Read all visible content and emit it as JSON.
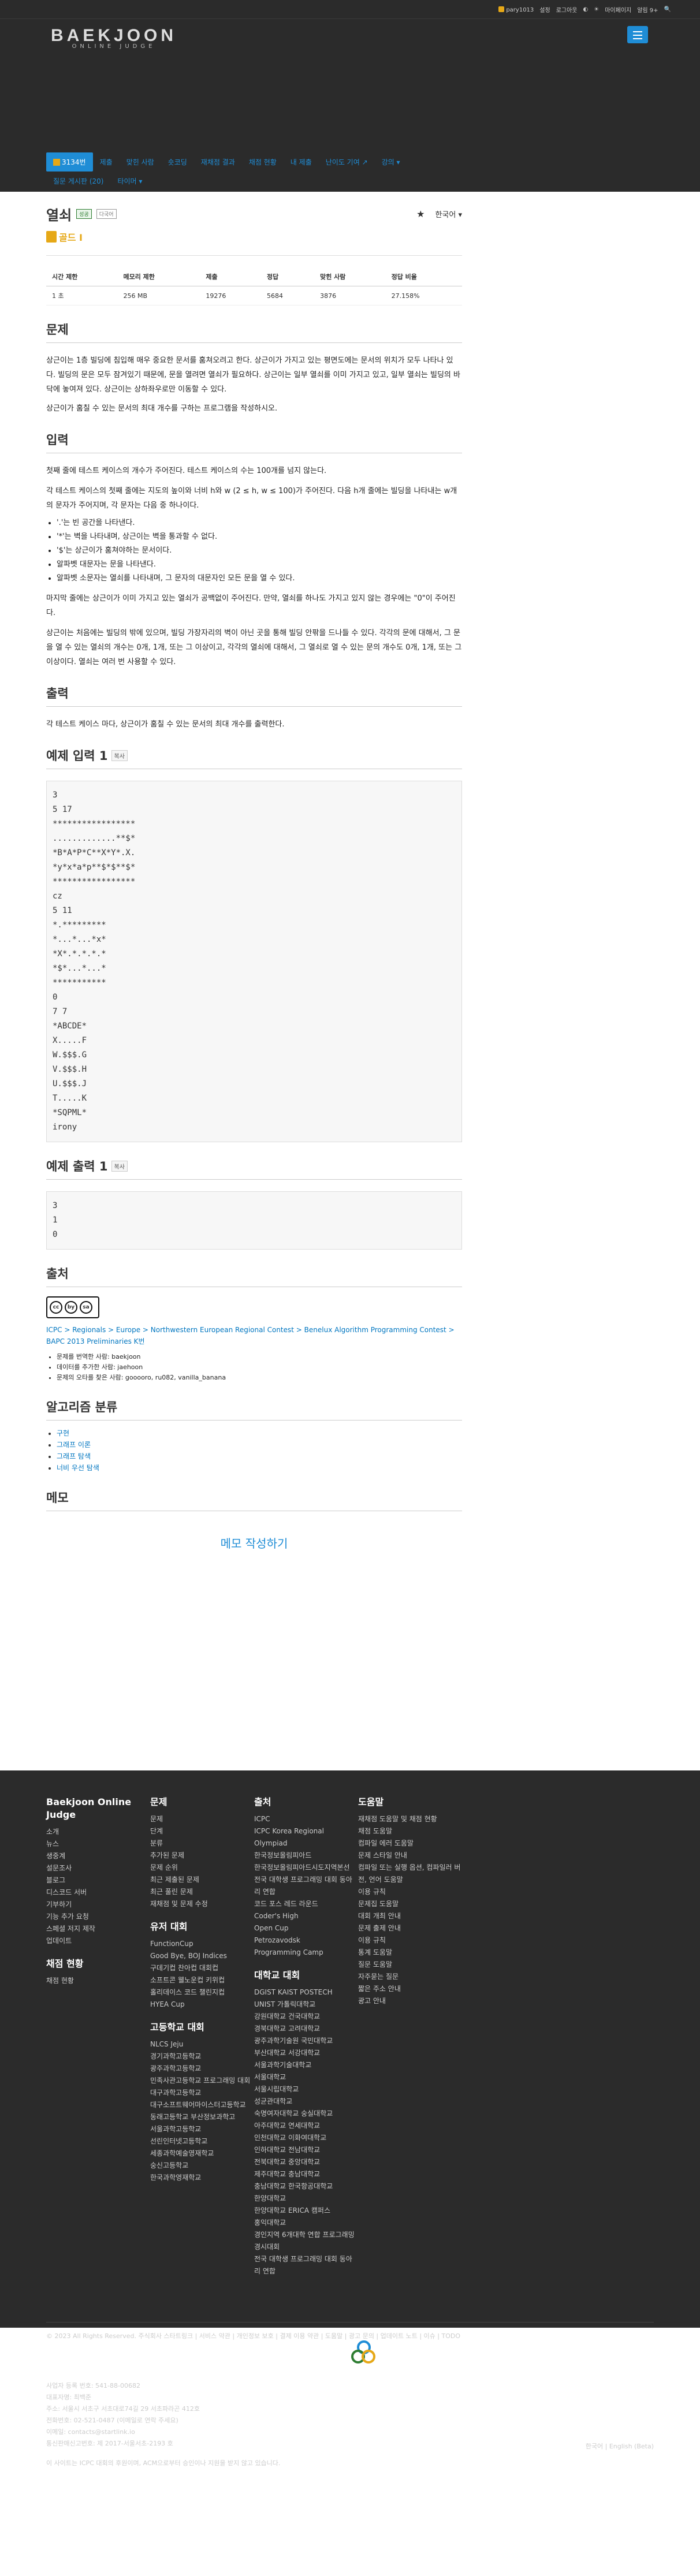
{
  "topbar": {
    "user": "pary1013",
    "links": [
      "설정",
      "로그아웃",
      "◐",
      "☀",
      "마이페이지",
      "알림 9+",
      "🔍"
    ]
  },
  "logo": {
    "main": "BAEKJOON",
    "sub": "ONLINE JUDGE"
  },
  "nav": {
    "tabs": [
      "3134번",
      "제출",
      "맞힌 사람",
      "숏코딩",
      "재채점 결과",
      "채점 현황",
      "내 제출",
      "난이도 기여 ↗",
      "강의 ▾",
      "질문 게시판 (20)",
      "타이머 ▾"
    ]
  },
  "problem": {
    "title": "열쇠",
    "badge_ok": "성공",
    "badge_other": "다국어",
    "star": "★",
    "lang": "한국어 ▾",
    "tier": "골드 I"
  },
  "info_table": {
    "headers": [
      "시간 제한",
      "메모리 제한",
      "제출",
      "정답",
      "맞힌 사람",
      "정답 비율"
    ],
    "row": [
      "1 초",
      "256 MB",
      "19276",
      "5684",
      "3876",
      "27.158%"
    ]
  },
  "sections": {
    "problem_h": "문제",
    "problem_p1": "상근이는 1층 빌딩에 침입해 매우 중요한 문서를 훔쳐오려고 한다. 상근이가 가지고 있는 평면도에는 문서의 위치가 모두 나타나 있다. 빌딩의 문은 모두 잠겨있기 때문에, 문을 열려면 열쇠가 필요하다. 상근이는 일부 열쇠를 이미 가지고 있고, 일부 열쇠는 빌딩의 바닥에 놓여져 있다. 상근이는 상하좌우로만 이동할 수 있다.",
    "problem_p2": "상근이가 훔칠 수 있는 문서의 최대 개수를 구하는 프로그램을 작성하시오.",
    "input_h": "입력",
    "input_p1": "첫째 줄에 테스트 케이스의 개수가 주어진다. 테스트 케이스의 수는 100개를 넘지 않는다.",
    "input_p2": "각 테스트 케이스의 첫째 줄에는 지도의 높이와 너비 h와 w (2 ≤ h, w ≤ 100)가 주어진다. 다음 h개 줄에는 빌딩을 나타내는 w개의 문자가 주어지며, 각 문자는 다음 중 하나이다.",
    "input_list": [
      "'.'는 빈 공간을 나타낸다.",
      "'*'는 벽을 나타내며, 상근이는 벽을 통과할 수 없다.",
      "'$'는 상근이가 훔쳐야하는 문서이다.",
      "알파벳 대문자는 문을 나타낸다.",
      "알파벳 소문자는 열쇠를 나타내며, 그 문자의 대문자인 모든 문을 열 수 있다."
    ],
    "input_p3": "마지막 줄에는 상근이가 이미 가지고 있는 열쇠가 공백없이 주어진다. 만약, 열쇠를 하나도 가지고 있지 않는 경우에는 \"0\"이 주어진다.",
    "input_p4": "상근이는 처음에는 빌딩의 밖에 있으며, 빌딩 가장자리의 벽이 아닌 곳을 통해 빌딩 안팎을 드나들 수 있다. 각각의 문에 대해서, 그 문을 열 수 있는 열쇠의 개수는 0개, 1개, 또는 그 이상이고, 각각의 열쇠에 대해서, 그 열쇠로 열 수 있는 문의 개수도 0개, 1개, 또는 그 이상이다. 열쇠는 여러 번 사용할 수 있다.",
    "output_h": "출력",
    "output_p": "각 테스트 케이스 마다, 상근이가 훔칠 수 있는 문서의 최대 개수를 출력한다.",
    "sample_in_h": "예제 입력 1",
    "sample_in": "3\n5 17\n*****************\n.............**$*\n*B*A*P*C**X*Y*.X.\n*y*x*a*p**$*$**$*\n*****************\ncz\n5 11\n*.*********\n*...*...*x*\n*X*.*.*.*.*\n*$*...*...*\n***********\n0\n7 7\n*ABCDE*\nX.....F\nW.$$$.G\nV.$$$.H\nU.$$$.J\nT.....K\n*SQPML*\nirony",
    "sample_out_h": "예제 출력 1",
    "sample_out": "3\n1\n0",
    "copy": "복사",
    "source_h": "출처",
    "source_link": "ICPC > Regionals > Europe > Northwestern European Regional Contest > Benelux Algorithm Programming Contest > BAPC 2013 Preliminaries K번",
    "source_items": [
      "문제를 번역한 사람: baekjoon",
      "데이터를 추가한 사람: jaehoon",
      "문제의 오타를 찾은 사람: gooooro, ru082, vanilla_banana"
    ],
    "cc": [
      "cc",
      "by",
      "sa"
    ],
    "algo_h": "알고리즘 분류",
    "algo": [
      "구현",
      "그래프 이론",
      "그래프 탐색",
      "너비 우선 탐색"
    ],
    "memo_h": "메모",
    "memo_btn": "메모 작성하기"
  },
  "footer": {
    "col1_title": "Baekjoon Online Judge",
    "col1": [
      "소개",
      "뉴스",
      "생중계",
      "설문조사",
      "블로그",
      "디스코드 서버",
      "기부하기",
      "기능 추가 요청",
      "스페셜 저지 제작",
      "업데이트"
    ],
    "col1b_title": "채점 현황",
    "col1b": [
      "채점 현황"
    ],
    "col2_title": "문제",
    "col2": [
      "문제",
      "단계",
      "분류",
      "추가된 문제",
      "문제 순위",
      "최근 제출된 문제",
      "최근 풀린 문제",
      "재채점 및 문제 수정"
    ],
    "col2b_title": "유저 대회",
    "col2b": [
      "FunctionCup",
      "Good Bye, BOJ Indices",
      "구데기컵 찬아컵 대회컵",
      "소프트콘 웰노운컵 키위컵",
      "홀리데이스 코드 챌린지컵",
      "HYEA Cup"
    ],
    "col2c_title": "고등학교 대회",
    "col2c": [
      "NLCS Jeju",
      "경기과학고등학교",
      "광주과학고등학교",
      "민족사관고등학교 프로그래밍 대회",
      "대구과학고등학교",
      "대구소프트웨어마이스터고등학교",
      "동래고등학교 부산정보과학고",
      "서울과학고등학교",
      "선린인터넷고등학교",
      "세종과학예술영재학교",
      "숭신고등학교",
      "한국과학영재학교"
    ],
    "col3_title": "출처",
    "col3": [
      "ICPC",
      "ICPC Korea Regional",
      "Olympiad",
      "한국정보올림피아드",
      "한국정보올림피아드시도지역본선",
      "전국 대학생 프로그래밍 대회 동아리 연합",
      "코드 포스 레드 라운드",
      "Coder's High",
      "Open Cup",
      "Petrozavodsk",
      "Programming Camp"
    ],
    "col3b_title": "대학교 대회",
    "col3b": [
      "DGIST KAIST POSTECH",
      "UNIST 가톨릭대학교",
      "강원대학교 건국대학교",
      "경북대학교 고려대학교",
      "광주과학기술원 국민대학교",
      "부산대학교 서강대학교",
      "서울과학기술대학교",
      "서울대학교",
      "서울시립대학교",
      "성균관대학교",
      "숙명여자대학교 숭실대학교",
      "아주대학교 연세대학교",
      "인천대학교 이화여대학교",
      "인하대학교 전남대학교",
      "전북대학교 중앙대학교",
      "제주대학교 충남대학교",
      "충남대학교 한국항공대학교",
      "한양대학교",
      "한양대학교 ERICA 캠퍼스",
      "홍익대학교",
      "경인지역 6개대학 연합 프로그래밍 경시대회",
      "전국 대학생 프로그래밍 대회 동아리 연합"
    ],
    "col4_title": "도움말",
    "col4": [
      "재채점 도움말 및 채점 현황",
      "채점 도움말",
      "컴파일 에러 도움말",
      "문제 스타일 안내",
      "컴파일 또는 실행 옵션, 컴파일러 버전, 언어 도움말",
      "이용 규칙",
      "문제집 도움말",
      "대회 개최 안내",
      "문제 출제 안내",
      "이용 규칙",
      "통계 도움말",
      "질문 도움말",
      "자주묻는 질문",
      "짧은 주소 안내",
      "광고 안내"
    ],
    "bottom1": "© 2023 All Rights Reserved. 주식회사 스타트링크 | 서비스 약관 | 개인정보 보호 | 결제 이용 약관 | 도움말 | 광고 문의 | 업데이트 노트 | 이슈 | TODO",
    "company": [
      "사업자 등록 번호: 541-88-00682",
      "대표자명: 최백준",
      "주소: 서울시 서초구 서초대로74길 29 서초파라곤 412호",
      "전화번호: 02-521-0487 (이메일로 연락 주세요)",
      "이메일: contacts@startlink.io",
      "통신판매신고번호: 제 2017-서울서초-2193 호"
    ],
    "icpc_note": "이 사이트는 ICPC 대회의 후원이며, ACM으로부터 승인이나 지원을 받지 않고 있습니다.",
    "lang": "한국어 | English (Beta)",
    "brand": "STARTLINK"
  },
  "colors": {
    "accent": "#1f8dd6",
    "gold": "#e6a817",
    "dark": "#2b2b2b"
  }
}
